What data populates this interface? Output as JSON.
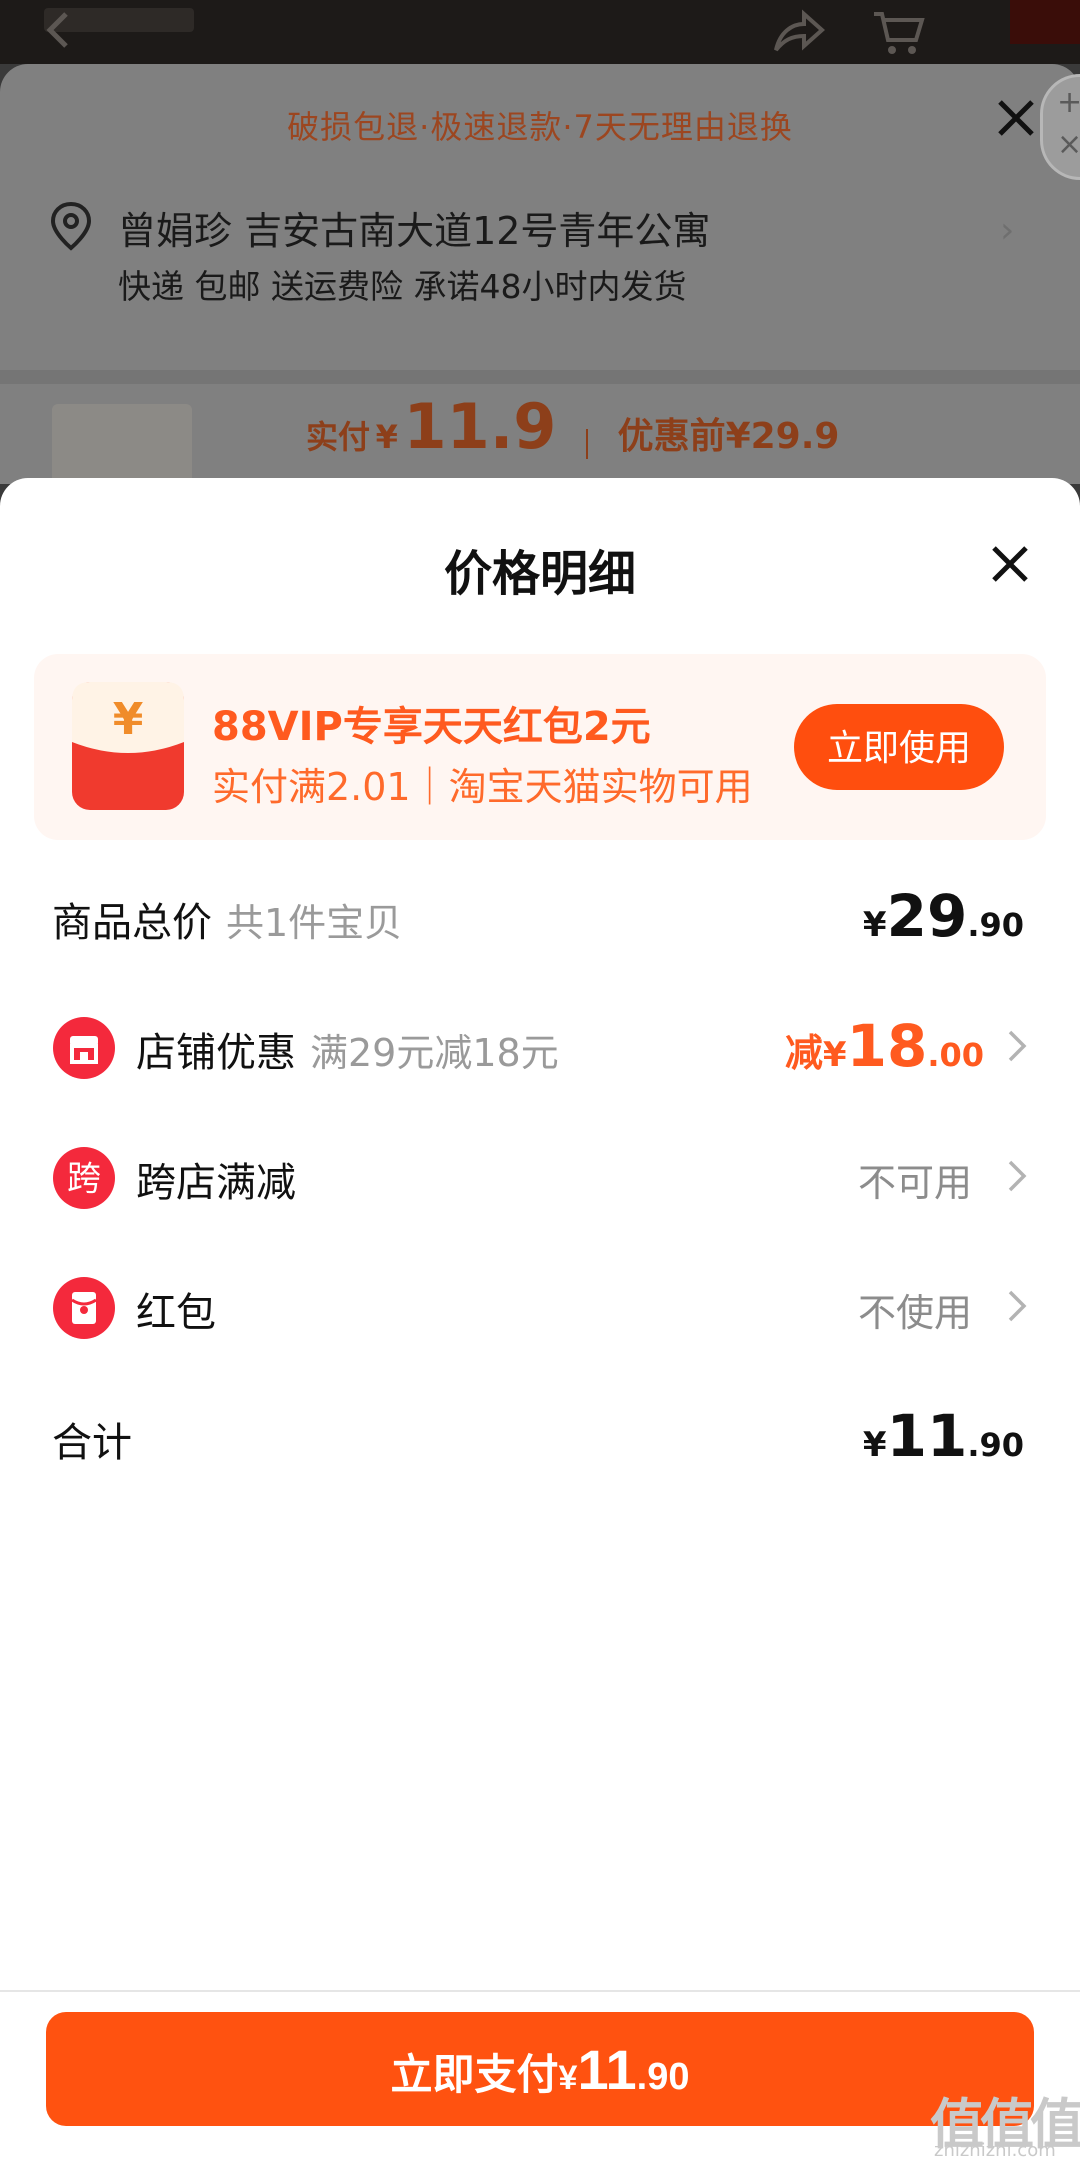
{
  "background": {
    "promise_text": "破损包退·极速退款·7天无理由退换",
    "address": {
      "name_line": "曾娟珍 吉安古南大道12号青年公寓",
      "delivery_line": "快递 包邮 送运费险 承诺48小时内发货"
    },
    "price": {
      "paid_label": "实付",
      "currency": "¥",
      "paid_value": "11.9",
      "original_label": "优惠前¥29.9"
    }
  },
  "sheet": {
    "title": "价格明细",
    "promo": {
      "icon_char": "¥",
      "title": "88VIP专享天天红包2元",
      "subtitle": "实付满2.01｜淘宝天猫实物可用",
      "button": "立即使用"
    },
    "rows": [
      {
        "label": "商品总价",
        "note": "共1件宝贝",
        "currency": "¥",
        "int": "29",
        "dec": ".90"
      },
      {
        "label": "店铺优惠",
        "note": "满29元减18元",
        "prefix": "减",
        "currency": "¥",
        "int": "18",
        "dec": ".00",
        "icon": "store-icon"
      },
      {
        "label": "跨店满减",
        "status": "不可用",
        "icon_char": "跨",
        "icon": "cross-store-icon"
      },
      {
        "label": "红包",
        "status": "不使用",
        "icon": "red-packet-icon"
      },
      {
        "label": "合计",
        "currency": "¥",
        "int": "11",
        "dec": ".90"
      }
    ],
    "pay_button": {
      "label": "立即支付",
      "currency": "¥",
      "int": "11",
      "dec": ".90"
    }
  },
  "watermark": {
    "logo": "值值值",
    "url": "zhizhizhi.com"
  },
  "colors": {
    "accent": "#ff5210",
    "discount": "#ff5a1f",
    "promo_bg": "#fff6f2"
  }
}
